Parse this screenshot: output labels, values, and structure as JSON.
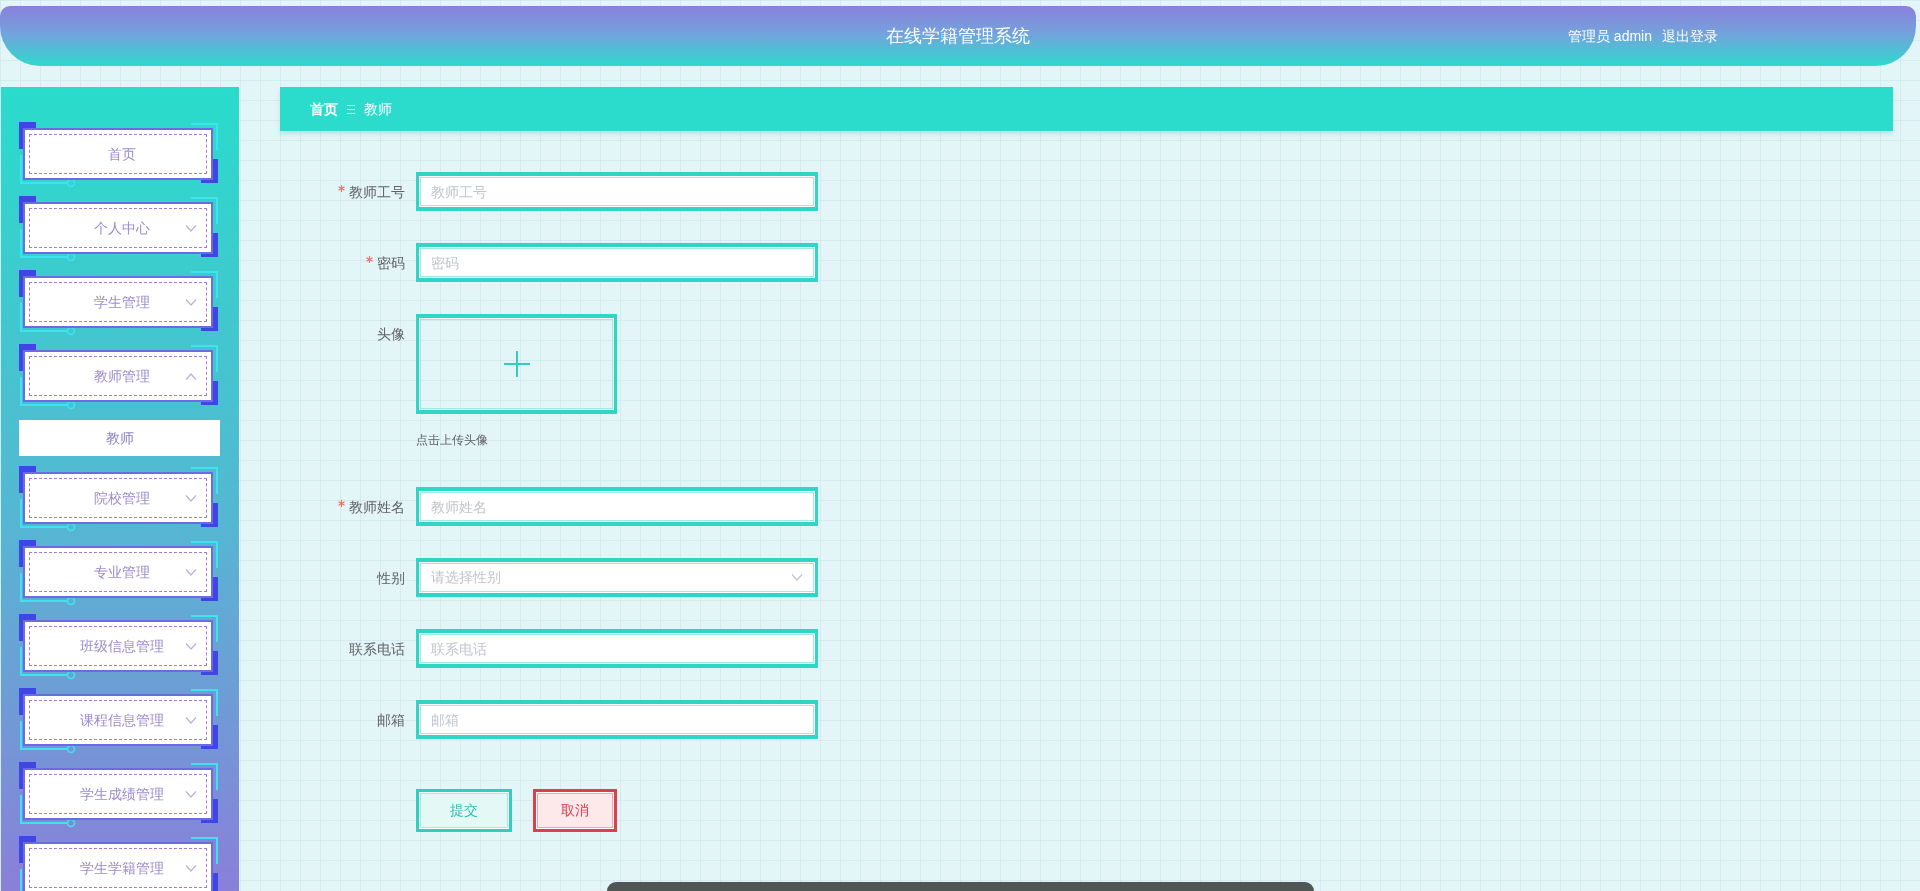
{
  "header": {
    "title": "在线学籍管理系统",
    "user": "管理员 admin",
    "logout": "退出登录"
  },
  "sidebar": {
    "items": [
      {
        "label": "首页",
        "kind": "link"
      },
      {
        "label": "个人中心",
        "kind": "menu",
        "expanded": false
      },
      {
        "label": "学生管理",
        "kind": "menu",
        "expanded": false
      },
      {
        "label": "教师管理",
        "kind": "menu",
        "expanded": true,
        "children": [
          {
            "label": "教师"
          }
        ]
      },
      {
        "label": "院校管理",
        "kind": "menu",
        "expanded": false
      },
      {
        "label": "专业管理",
        "kind": "menu",
        "expanded": false
      },
      {
        "label": "班级信息管理",
        "kind": "menu",
        "expanded": false
      },
      {
        "label": "课程信息管理",
        "kind": "menu",
        "expanded": false
      },
      {
        "label": "学生成绩管理",
        "kind": "menu",
        "expanded": false
      },
      {
        "label": "学生学籍管理",
        "kind": "menu",
        "expanded": false
      }
    ]
  },
  "breadcrumb": [
    {
      "label": "首页",
      "kind": "link"
    },
    {
      "label": "教师",
      "kind": "current"
    }
  ],
  "form": {
    "fields": [
      {
        "label": "教师工号",
        "required": true,
        "kind": "input",
        "placeholder": "教师工号"
      },
      {
        "label": "密码",
        "required": true,
        "kind": "input",
        "placeholder": "密码"
      },
      {
        "label": "头像",
        "required": false,
        "kind": "upload",
        "hint": "点击上传头像"
      },
      {
        "label": "教师姓名",
        "required": true,
        "kind": "input",
        "placeholder": "教师姓名"
      },
      {
        "label": "性别",
        "required": false,
        "kind": "select",
        "placeholder": "请选择性别"
      },
      {
        "label": "联系电话",
        "required": false,
        "kind": "input",
        "placeholder": "联系电话"
      },
      {
        "label": "邮箱",
        "required": false,
        "kind": "input",
        "placeholder": "邮箱"
      }
    ],
    "buttons": [
      {
        "label": "提交",
        "kind": "primary"
      },
      {
        "label": "取消",
        "kind": "danger"
      }
    ]
  }
}
